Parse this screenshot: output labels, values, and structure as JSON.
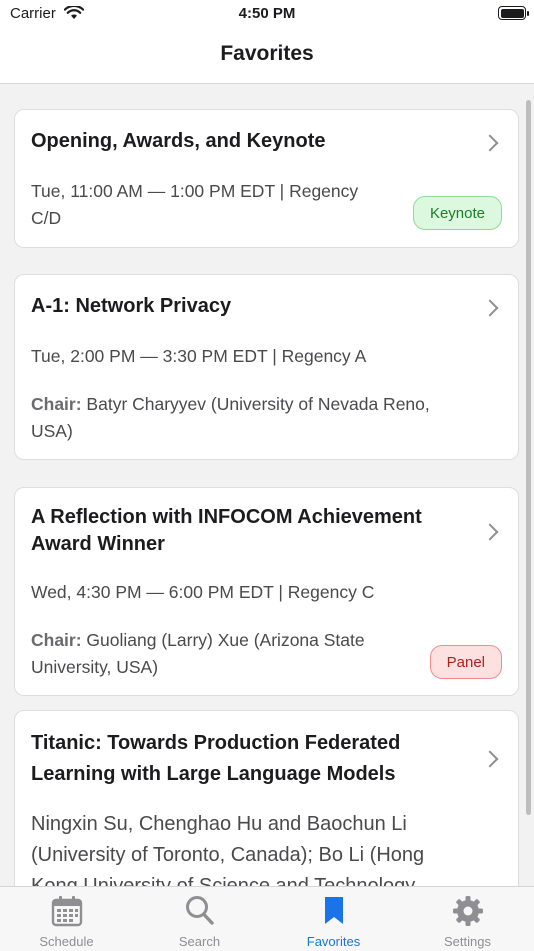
{
  "status": {
    "carrier": "Carrier",
    "time": "4:50 PM"
  },
  "nav": {
    "title": "Favorites"
  },
  "sessions": [
    {
      "title": "Opening, Awards, and Keynote",
      "time_line1": "Tue, 11:00 AM — 1:00 PM EDT | Regency",
      "time_line2": "C/D",
      "badge": "Keynote",
      "badge_color": "#dcf8df"
    },
    {
      "title": "A-1: Network Privacy",
      "time_line1": "Tue, 2:00 PM — 3:30 PM EDT | Regency A",
      "chair_label": "Chair:",
      "chair_line1": " Batyr Charyyev (University of Nevada Reno,",
      "chair_line2": "USA)"
    },
    {
      "title_line1": "A Reflection with INFOCOM Achievement",
      "title_line2": "Award Winner",
      "time_line1": "Wed, 4:30 PM — 6:00 PM EDT | Regency C",
      "chair_label": "Chair:",
      "chair_line1": " Guoliang (Larry) Xue (Arizona State",
      "chair_line2": "University, USA)",
      "badge": "Panel",
      "badge_color": "#fde1e1"
    },
    {
      "title_line1": "Titanic: Towards Production Federated",
      "title_line2": "Learning with Large Language Models",
      "authors_line1": "Ningxin Su, Chenghao Hu and Baochun Li",
      "authors_line2": "(University of Toronto, Canada); Bo Li (Hong",
      "authors_line3": "Kong University of Science and Technology"
    }
  ],
  "tabs": [
    {
      "label": "Schedule",
      "icon": "calendar-icon"
    },
    {
      "label": "Search",
      "icon": "search-icon"
    },
    {
      "label": "Favorites",
      "icon": "bookmark-icon",
      "active": true
    },
    {
      "label": "Settings",
      "icon": "gear-icon"
    }
  ],
  "colors": {
    "accent": "#1a73e8",
    "inactive": "#8e8e93"
  }
}
